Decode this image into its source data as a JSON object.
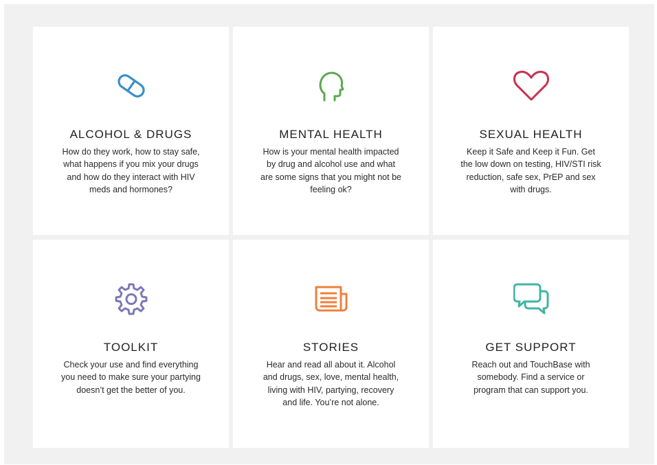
{
  "cards": [
    {
      "title": "ALCOHOL & DRUGS",
      "desc": "How do they work, how to stay safe, what happens if you mix your drugs and how do they interact with HIV meds and hormones?",
      "icon": "pill-icon",
      "color": "#3a8fc9"
    },
    {
      "title": "MENTAL HEALTH",
      "desc": "How is your mental health impacted by drug and alcohol use and what are some signs that you might not be feeling ok?",
      "icon": "head-icon",
      "color": "#5aa94d"
    },
    {
      "title": "SEXUAL HEALTH",
      "desc": "Keep it Safe and Keep it Fun. Get the low down on testing, HIV/STI risk reduction, safe sex, PrEP and sex with drugs.",
      "icon": "heart-icon",
      "color": "#c8304f"
    },
    {
      "title": "TOOLKIT",
      "desc": "Check your use and find everything you need to make sure your partying doesn’t get the better of you.",
      "icon": "gear-icon",
      "color": "#7a78b8"
    },
    {
      "title": "STORIES",
      "desc": "Hear and read all about it. Alcohol and drugs, sex, love, mental health, living with HIV, partying, recovery and life. You’re not alone.",
      "icon": "newspaper-icon",
      "color": "#f07f3a"
    },
    {
      "title": "GET SUPPORT",
      "desc": "Reach out and TouchBase with somebody. Find a service or program that can support you.",
      "icon": "chat-bubbles-icon",
      "color": "#3fb5a3"
    }
  ]
}
